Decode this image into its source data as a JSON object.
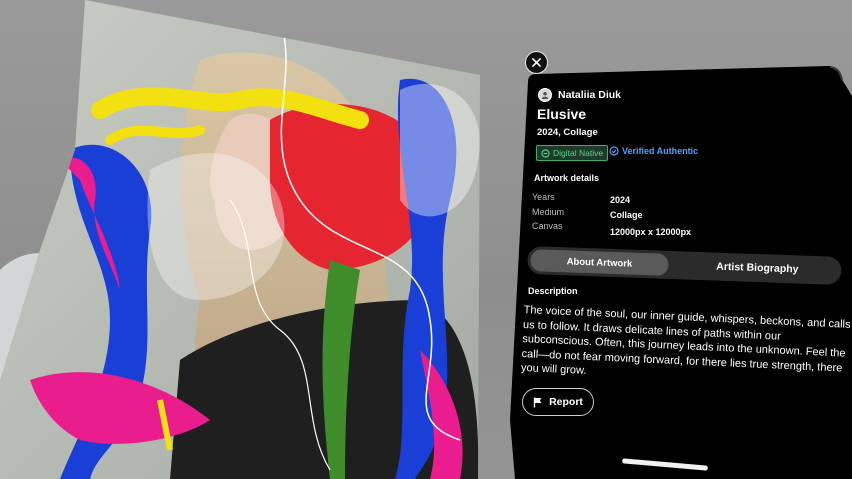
{
  "artist": {
    "name": "Nataliia Diuk"
  },
  "artwork": {
    "title": "Elusive",
    "subtitle": "2024, Collage",
    "badge_native": "Digital Native",
    "badge_verified": "Verified Authentic"
  },
  "details": {
    "heading": "Artwork details",
    "rows": [
      {
        "label": "Years",
        "value": "2024"
      },
      {
        "label": "Medium",
        "value": "Collage"
      },
      {
        "label": "Canvas",
        "value": "12000px x 12000px"
      }
    ]
  },
  "tabs": {
    "active": "About Artwork",
    "inactive": "Artist Biography"
  },
  "description": {
    "heading": "Description",
    "text": "The voice of the soul, our inner guide, whispers, beckons, and calls us to follow. It draws delicate lines of paths within our subconscious. Often, this journey leads into the unknown. Feel the call—do not fear moving forward, for there lies true strength, there you will grow."
  },
  "report_label": "Report",
  "icons": {
    "close": "close-icon",
    "avatar": "artist-avatar",
    "native": "digital-native-icon",
    "verified": "verified-check-icon",
    "report": "flag-icon"
  },
  "colors": {
    "panel": "#000000",
    "verified": "#4ea3ff",
    "native": "#3fae6a"
  }
}
